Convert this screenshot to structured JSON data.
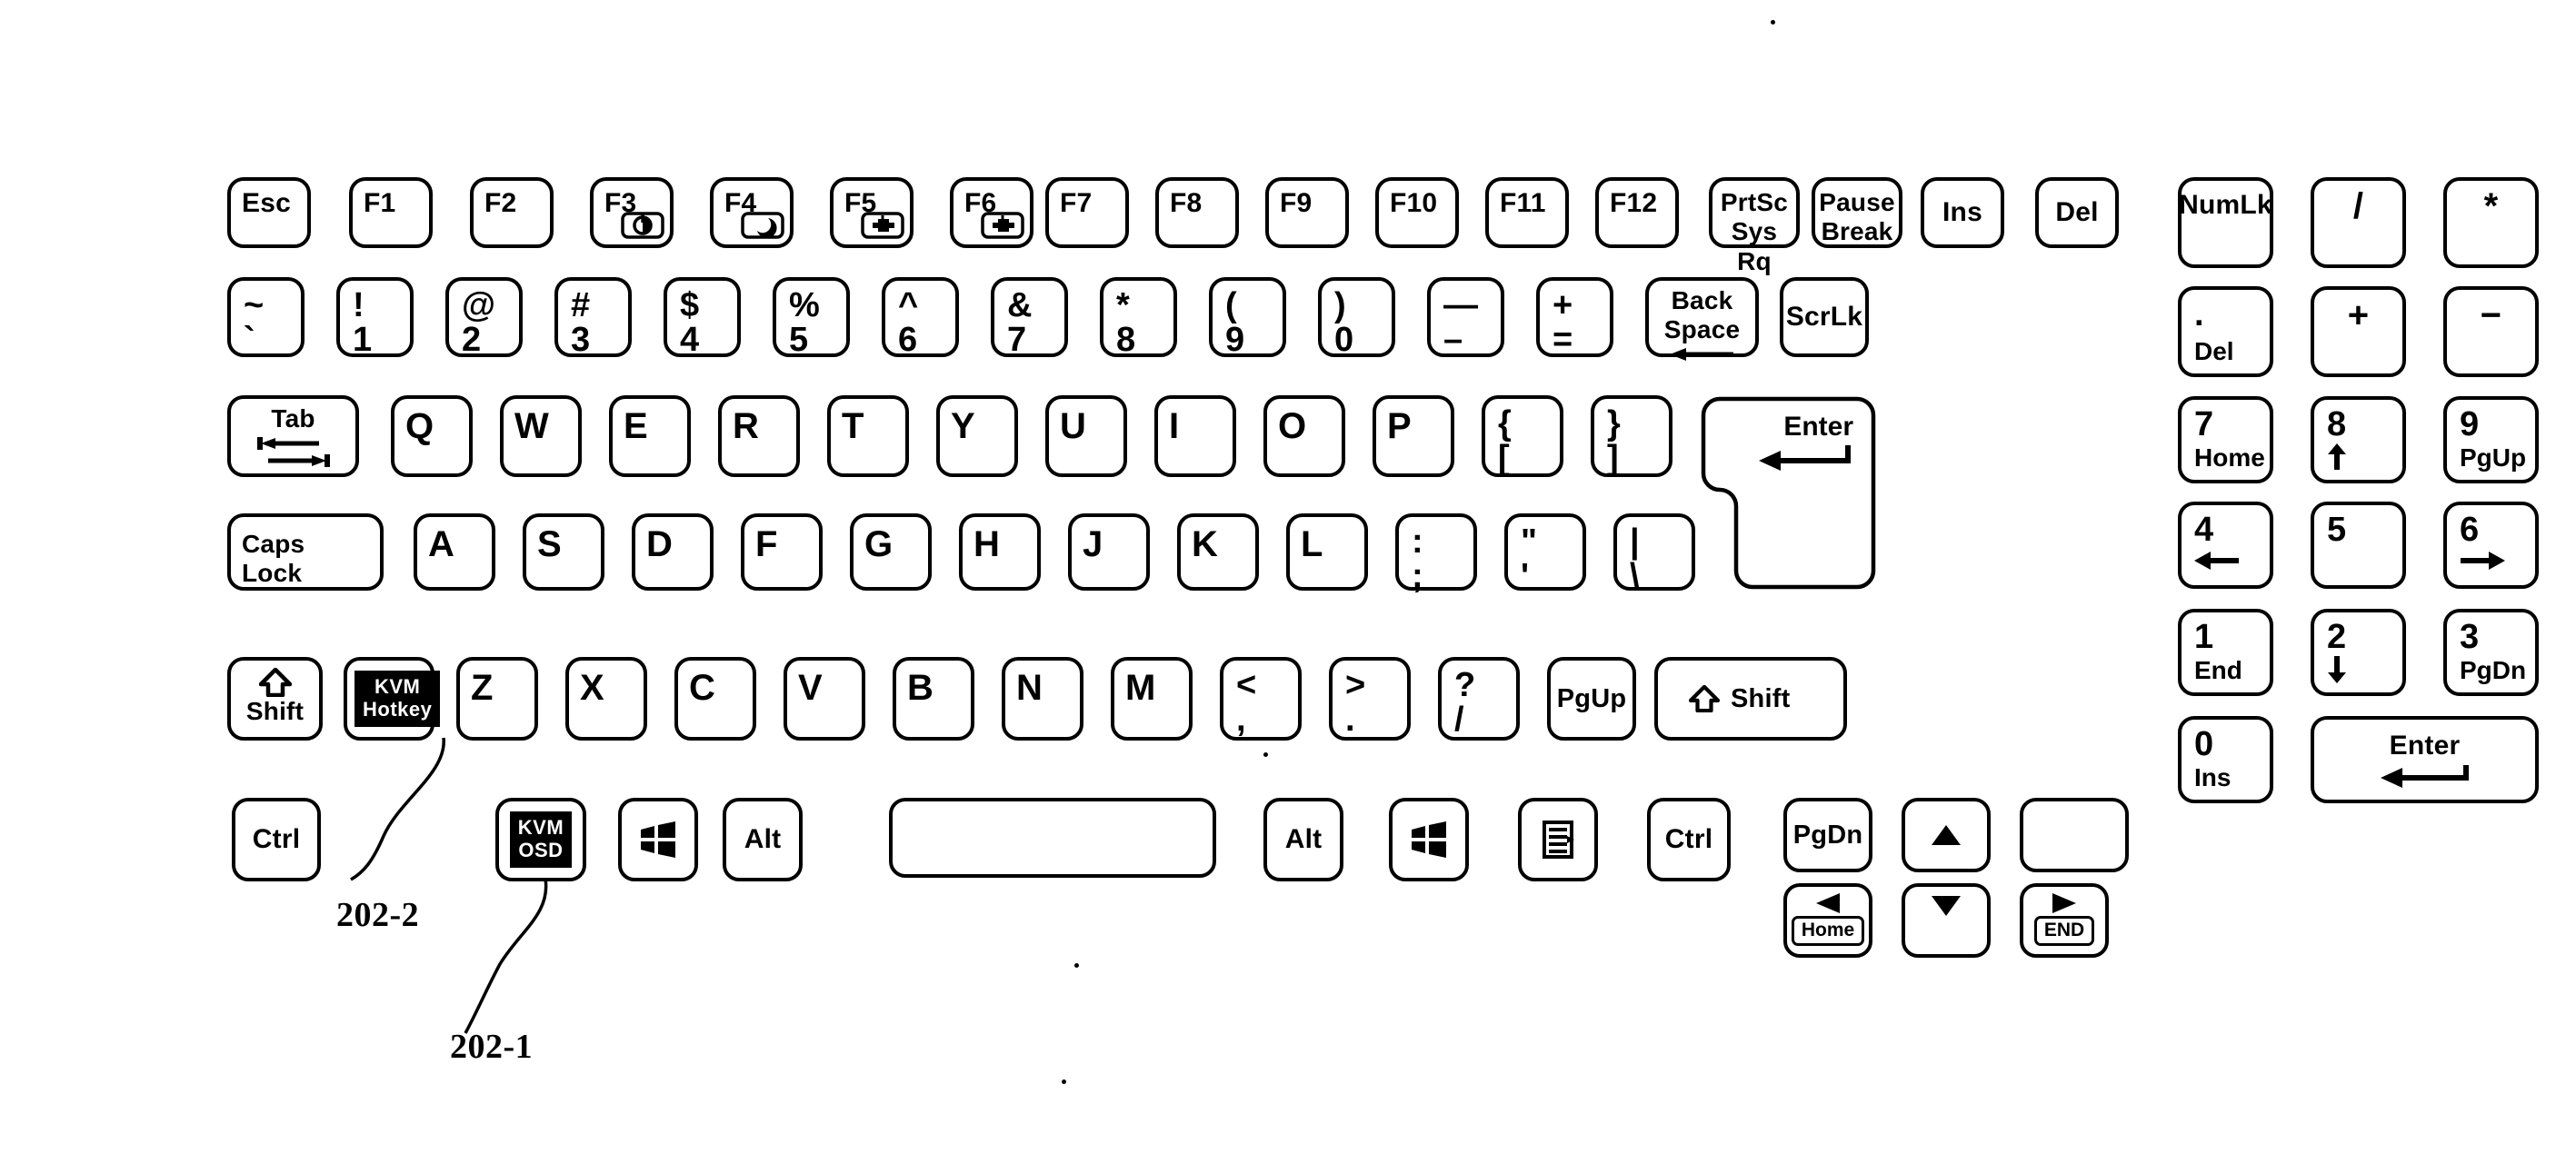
{
  "figure": {
    "type": "patent-keyboard-diagram",
    "reference_numerals": [
      {
        "id": "ref-202-2",
        "text": "202-2",
        "points_to": "KVM Hotkey key"
      },
      {
        "id": "ref-202-1",
        "text": "202-1",
        "points_to": "KVM OSD key"
      }
    ]
  },
  "keyboard": {
    "function_row": [
      {
        "label": "Esc"
      },
      {
        "label": "F1"
      },
      {
        "label": "F2"
      },
      {
        "label": "F3",
        "icon": "power-icon"
      },
      {
        "label": "F4",
        "icon": "sleep-moon-icon"
      },
      {
        "label": "F5",
        "icon": "wake-icon"
      },
      {
        "label": "F6",
        "icon": "wake-icon"
      },
      {
        "label": "F7"
      },
      {
        "label": "F8"
      },
      {
        "label": "F9"
      },
      {
        "label": "F10"
      },
      {
        "label": "F11"
      },
      {
        "label": "F12"
      },
      {
        "label": "PrtSc\nSys Rq"
      },
      {
        "label": "Pause\nBreak"
      },
      {
        "label": "Ins"
      },
      {
        "label": "Del"
      }
    ],
    "number_row": [
      {
        "top": "~",
        "bottom": "`"
      },
      {
        "top": "!",
        "bottom": "1"
      },
      {
        "top": "@",
        "bottom": "2"
      },
      {
        "top": "#",
        "bottom": "3"
      },
      {
        "top": "$",
        "bottom": "4"
      },
      {
        "top": "%",
        "bottom": "5"
      },
      {
        "top": "^",
        "bottom": "6"
      },
      {
        "top": "&",
        "bottom": "7"
      },
      {
        "top": "*",
        "bottom": "8"
      },
      {
        "top": "(",
        "bottom": "9"
      },
      {
        "top": ")",
        "bottom": "0"
      },
      {
        "top": "—",
        "bottom": "–"
      },
      {
        "top": "+",
        "bottom": "="
      },
      {
        "label": "Back\nSpace",
        "icon": "left-arrow-icon"
      },
      {
        "label": "ScrLk"
      }
    ],
    "qwerty_row": [
      {
        "label": "Tab",
        "icon": "tab-arrows-icon"
      },
      {
        "label": "Q"
      },
      {
        "label": "W"
      },
      {
        "label": "E"
      },
      {
        "label": "R"
      },
      {
        "label": "T"
      },
      {
        "label": "Y"
      },
      {
        "label": "U"
      },
      {
        "label": "I"
      },
      {
        "label": "O"
      },
      {
        "label": "P"
      },
      {
        "top": "{",
        "bottom": "["
      },
      {
        "top": "}",
        "bottom": "]"
      },
      {
        "label": "Enter",
        "icon": "enter-arrow-icon"
      }
    ],
    "home_row": [
      {
        "label": "Caps\nLock"
      },
      {
        "label": "A"
      },
      {
        "label": "S"
      },
      {
        "label": "D"
      },
      {
        "label": "F"
      },
      {
        "label": "G"
      },
      {
        "label": "H"
      },
      {
        "label": "J"
      },
      {
        "label": "K"
      },
      {
        "label": "L"
      },
      {
        "top": ":",
        "bottom": ";"
      },
      {
        "top": "\"",
        "bottom": "'"
      },
      {
        "top": "|",
        "bottom": "\\"
      }
    ],
    "shift_row": [
      {
        "label": "Shift",
        "icon": "shift-up-arrow-icon"
      },
      {
        "label": "KVM\nHotkey",
        "kind": "kvm-badge",
        "ref": "202-2"
      },
      {
        "label": "Z"
      },
      {
        "label": "X"
      },
      {
        "label": "C"
      },
      {
        "label": "V"
      },
      {
        "label": "B"
      },
      {
        "label": "N"
      },
      {
        "label": "M"
      },
      {
        "top": "<",
        "bottom": ","
      },
      {
        "top": ">",
        "bottom": "."
      },
      {
        "top": "?",
        "bottom": "/"
      },
      {
        "label": "PgUp"
      },
      {
        "label": "Shift",
        "icon": "shift-up-arrow-icon"
      }
    ],
    "bottom_row": [
      {
        "label": "Ctrl"
      },
      {
        "label": "KVM\nOSD",
        "kind": "kvm-badge",
        "ref": "202-1"
      },
      {
        "label": "",
        "icon": "windows-icon"
      },
      {
        "label": "Alt"
      },
      {
        "label": "",
        "icon": "space-bar"
      },
      {
        "label": "Alt"
      },
      {
        "label": "",
        "icon": "windows-icon"
      },
      {
        "label": "",
        "icon": "menu-icon"
      },
      {
        "label": "Ctrl"
      },
      {
        "label": "PgDn"
      }
    ],
    "arrow_cluster": [
      {
        "label": "",
        "icon": "arrow-up-icon"
      },
      {
        "label": "",
        "icon": "arrow-down-icon"
      },
      {
        "label": "Home",
        "icon": "arrow-left-icon",
        "boxed": true
      },
      {
        "label": "END",
        "icon": "arrow-right-icon",
        "boxed": true
      },
      {
        "label": ""
      }
    ],
    "numpad": [
      {
        "label": "NumLk"
      },
      {
        "label": "/"
      },
      {
        "label": "*"
      },
      {
        "top": ".",
        "bottom": "Del"
      },
      {
        "label": "+"
      },
      {
        "label": "−"
      },
      {
        "top": "7",
        "bottom": "Home"
      },
      {
        "top": "8",
        "bottom": "",
        "icon": "arrow-up-icon"
      },
      {
        "top": "9",
        "bottom": "PgUp"
      },
      {
        "top": "4",
        "bottom": "",
        "icon": "arrow-left-icon"
      },
      {
        "top": "5",
        "bottom": ""
      },
      {
        "top": "6",
        "bottom": "",
        "icon": "arrow-right-icon"
      },
      {
        "top": "1",
        "bottom": "End"
      },
      {
        "top": "2",
        "bottom": "",
        "icon": "arrow-down-icon"
      },
      {
        "top": "3",
        "bottom": "PgDn"
      },
      {
        "top": "0",
        "bottom": "Ins"
      },
      {
        "label": "Enter",
        "icon": "enter-arrow-icon"
      }
    ]
  },
  "colors": {
    "ink": "#000000",
    "paper": "#ffffff",
    "badge_bg": "#000000",
    "badge_fg": "#ffffff"
  }
}
